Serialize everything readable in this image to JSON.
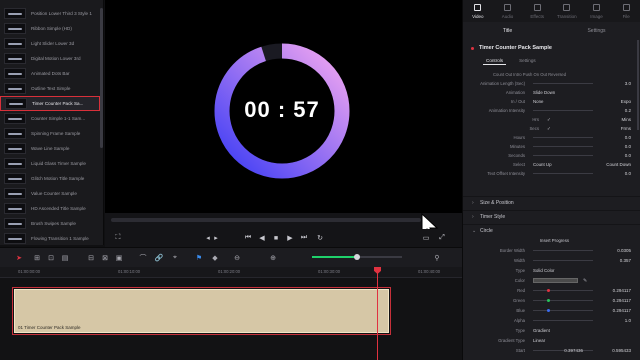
{
  "library": {
    "items": [
      {
        "label": "Position Lower Third 3 Style 1"
      },
      {
        "label": "Ribbon Simple (HD)"
      },
      {
        "label": "Light Slider Lower 3d"
      },
      {
        "label": "Digital Motion Lower 3rd"
      },
      {
        "label": "Animated Dots Bar"
      },
      {
        "label": "Outline Text Simple"
      },
      {
        "label": "Timer Counter Pack Sa..."
      },
      {
        "label": "Counter Simple 1-1 Sam..."
      },
      {
        "label": "Spinning Frame Sample"
      },
      {
        "label": "Wave Line Sample"
      },
      {
        "label": "Liquid Glass Timer Sample"
      },
      {
        "label": "Glitch Motion Title Sample"
      },
      {
        "label": "Value Counter Sample"
      },
      {
        "label": "HD Ascended Title Sample"
      },
      {
        "label": "Brush Swipes Sample"
      },
      {
        "label": "Flowing Transition 1 Sample"
      }
    ],
    "selected_index": 6
  },
  "viewer": {
    "timer_text": "00 : 57",
    "progress": 0.95,
    "ring_color_start": "#3b3bf5",
    "ring_color_end": "#f4a8f0"
  },
  "transport": {
    "timecode": "◂ ▸"
  },
  "timeline": {
    "ruler_ticks": [
      "01:00:00:00",
      "01:00:10:00",
      "01:00:20:00",
      "01:00:30:00",
      "01:00:40:00"
    ],
    "clip_name": "01 Timer Counter Pack Sample",
    "playhead_position": 0.82,
    "zoom_level": 0.5
  },
  "inspector": {
    "tabs": [
      "Video",
      "Audio",
      "Effects",
      "Transition",
      "Image",
      "File"
    ],
    "sub_tabs": [
      "Title",
      "Settings"
    ],
    "title": "Timer Counter Pack Sample",
    "control_tabs": [
      "Controls",
      "Settings"
    ],
    "note": "Count Out Intro Push On Out Reversed",
    "rows": [
      {
        "label": "Animation Length (Sec)",
        "value": "3.0"
      },
      {
        "label": "Animation",
        "value": "Slide Down"
      },
      {
        "label": "In / Out",
        "value": "None",
        "value2": "Expo"
      },
      {
        "label": "Animation Intensity",
        "value": "0.2"
      },
      {
        "label": "Hrs",
        "value": "Mins"
      },
      {
        "label": "Secs",
        "value": "Frms"
      },
      {
        "label": "Hours",
        "value": "0.0"
      },
      {
        "label": "Minutes",
        "value": "0.0"
      },
      {
        "label": "Seconds",
        "value": "0.0"
      },
      {
        "label": "Select",
        "value": "Count Up",
        "value2": "Count Down"
      },
      {
        "label": "Text Offset Intensity",
        "value": "0.0"
      }
    ],
    "sections": [
      {
        "label": "Size & Position"
      },
      {
        "label": "Timer Style"
      },
      {
        "label": "Circle"
      }
    ],
    "circle_rows": [
      {
        "label": "Insert Progress",
        "value": ""
      },
      {
        "label": "Border Width",
        "value": "0.0305"
      },
      {
        "label": "Width",
        "value": "0.357"
      },
      {
        "label": "Type",
        "value": "Solid Color"
      },
      {
        "label": "Color",
        "value": ""
      },
      {
        "label": "Red",
        "value": "0.294117"
      },
      {
        "label": "Green",
        "value": "0.294117"
      },
      {
        "label": "Blue",
        "value": "0.294117"
      },
      {
        "label": "Alpha",
        "value": "1.0"
      },
      {
        "label": "Type",
        "value": "Gradient"
      },
      {
        "label": "Gradient Type",
        "value": "Linear"
      },
      {
        "label": "Start",
        "value": "0.397436",
        "value2": "0.595433"
      }
    ],
    "colors": {
      "red": "#e03240",
      "green": "#25c45a",
      "blue": "#3a6bf0"
    }
  }
}
